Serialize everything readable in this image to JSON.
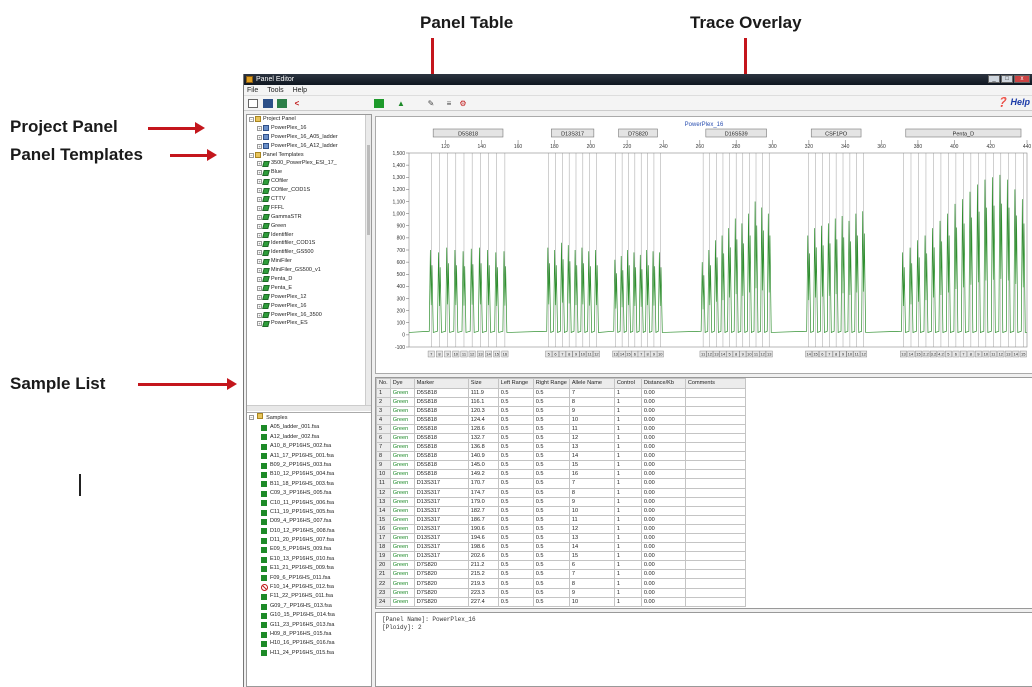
{
  "callouts": {
    "panel_table": "Panel Table",
    "trace_overlay": "Trace Overlay",
    "project_panel": "Project Panel",
    "panel_templates": "Panel Templates",
    "sample_list": "Sample List",
    "arrow_color": "#c4161c"
  },
  "window": {
    "title": "Panel Editor"
  },
  "menu": [
    "File",
    "Tools",
    "Help"
  ],
  "toolbar": {
    "help_label": "Help"
  },
  "tree": [
    {
      "label": "Project Panel",
      "level": 0,
      "pm": "−",
      "icon": "folder"
    },
    {
      "label": "PowerPlex_16",
      "level": 1,
      "pm": "+",
      "icon": "panel"
    },
    {
      "label": "PowerPlex_16_A05_ladder",
      "level": 1,
      "pm": "+",
      "icon": "panel"
    },
    {
      "label": "PowerPlex_16_A12_ladder",
      "level": 1,
      "pm": "+",
      "icon": "panel"
    },
    {
      "label": "Panel Templates",
      "level": 0,
      "pm": "−",
      "icon": "folder"
    },
    {
      "label": "3500_PowerPlex_ESI_17_",
      "level": 1,
      "pm": "+",
      "icon": "tmpl"
    },
    {
      "label": "Blue",
      "level": 1,
      "pm": "+",
      "icon": "tmpl"
    },
    {
      "label": "COfiler",
      "level": 1,
      "pm": "+",
      "icon": "tmpl"
    },
    {
      "label": "COfiler_COD1S",
      "level": 1,
      "pm": "+",
      "icon": "tmpl"
    },
    {
      "label": "CTTV",
      "level": 1,
      "pm": "+",
      "icon": "tmpl"
    },
    {
      "label": "FFFL",
      "level": 1,
      "pm": "+",
      "icon": "tmpl"
    },
    {
      "label": "GammaSTR",
      "level": 1,
      "pm": "+",
      "icon": "tmpl"
    },
    {
      "label": "Green",
      "level": 1,
      "pm": "+",
      "icon": "tmpl"
    },
    {
      "label": "Identifiler",
      "level": 1,
      "pm": "+",
      "icon": "tmpl"
    },
    {
      "label": "Identifiler_COD1S",
      "level": 1,
      "pm": "+",
      "icon": "tmpl"
    },
    {
      "label": "Identifiler_GS500",
      "level": 1,
      "pm": "+",
      "icon": "tmpl"
    },
    {
      "label": "MiniFiler",
      "level": 1,
      "pm": "+",
      "icon": "tmpl"
    },
    {
      "label": "MiniFiler_GS500_v1",
      "level": 1,
      "pm": "+",
      "icon": "tmpl"
    },
    {
      "label": "Penta_D",
      "level": 1,
      "pm": "+",
      "icon": "tmpl"
    },
    {
      "label": "Penta_E",
      "level": 1,
      "pm": "+",
      "icon": "tmpl"
    },
    {
      "label": "PowerPlex_12",
      "level": 1,
      "pm": "+",
      "icon": "tmpl"
    },
    {
      "label": "PowerPlex_16",
      "level": 1,
      "pm": "+",
      "icon": "tmpl"
    },
    {
      "label": "PowerPlex_16_3500",
      "level": 1,
      "pm": "+",
      "icon": "tmpl"
    },
    {
      "label": "PowerPlex_ES",
      "level": 1,
      "pm": "+",
      "icon": "tmpl"
    }
  ],
  "samples_root": "Samples",
  "samples": [
    {
      "name": "A05_ladder_001.fsa",
      "status": "ok"
    },
    {
      "name": "A12_ladder_002.fsa",
      "status": "ok"
    },
    {
      "name": "A10_8_PP16HS_002.fsa",
      "status": "ok"
    },
    {
      "name": "A11_17_PP16HS_001.fsa",
      "status": "ok"
    },
    {
      "name": "B09_2_PP16HS_003.fsa",
      "status": "ok"
    },
    {
      "name": "B10_12_PP16HS_004.fsa",
      "status": "ok"
    },
    {
      "name": "B11_18_PP16HS_003.fsa",
      "status": "ok"
    },
    {
      "name": "C09_3_PP16HS_005.fsa",
      "status": "ok"
    },
    {
      "name": "C10_11_PP16HS_006.fsa",
      "status": "ok"
    },
    {
      "name": "C11_19_PP16HS_005.fsa",
      "status": "ok"
    },
    {
      "name": "D09_4_PP16HS_007.fsa",
      "status": "ok"
    },
    {
      "name": "D10_12_PP16HS_008.fsa",
      "status": "ok"
    },
    {
      "name": "D11_20_PP16HS_007.fsa",
      "status": "ok"
    },
    {
      "name": "E09_5_PP16HS_009.fsa",
      "status": "ok"
    },
    {
      "name": "E10_13_PP16HS_010.fsa",
      "status": "ok"
    },
    {
      "name": "E11_21_PP16HS_009.fsa",
      "status": "ok"
    },
    {
      "name": "F09_6_PP16HS_011.fsa",
      "status": "ok"
    },
    {
      "name": "F10_14_PP16HS_012.fsa",
      "status": "error"
    },
    {
      "name": "F11_22_PP16HS_011.fsa",
      "status": "ok"
    },
    {
      "name": "G09_7_PP16HS_013.fsa",
      "status": "ok"
    },
    {
      "name": "G10_15_PP16HS_014.fsa",
      "status": "ok"
    },
    {
      "name": "G11_23_PP16HS_013.fsa",
      "status": "ok"
    },
    {
      "name": "H09_8_PP16HS_015.fsa",
      "status": "ok"
    },
    {
      "name": "H10_16_PP16HS_016.fsa",
      "status": "ok"
    },
    {
      "name": "H11_24_PP16HS_015.fsa",
      "status": "ok"
    }
  ],
  "chart_data": {
    "type": "line",
    "title": "PowerPlex_16",
    "xlim": [
      100,
      440
    ],
    "ylim": [
      -100,
      1500
    ],
    "x_ticks": [
      120,
      140,
      160,
      180,
      200,
      220,
      240,
      260,
      280,
      300,
      320,
      340,
      360,
      380,
      400,
      420,
      440
    ],
    "y_ticks": [
      -100,
      0,
      100,
      200,
      300,
      400,
      500,
      600,
      700,
      800,
      900,
      1000,
      1100,
      1200,
      1300,
      1400,
      1500
    ],
    "y_tick_labels": [
      "-100",
      "0",
      "100",
      "200",
      "300",
      "400",
      "500",
      "600",
      "700",
      "800",
      "900",
      "1,000",
      "1,100",
      "1,200",
      "1,300",
      "1,400",
      "1,500"
    ],
    "loci": [
      {
        "name": "D5S818",
        "start": 110,
        "end": 155,
        "heights": [
          700,
          680,
          720,
          700,
          690,
          710,
          720,
          700,
          680,
          690
        ],
        "peaks": 10
      },
      {
        "name": "D13S317",
        "start": 175,
        "end": 205,
        "heights": [
          720,
          700,
          760,
          740,
          700,
          720,
          690,
          700
        ],
        "peaks": 8
      },
      {
        "name": "D7S820",
        "start": 212,
        "end": 240,
        "heights": [
          620,
          650,
          700,
          680,
          660,
          700,
          690,
          680
        ],
        "peaks": 8
      },
      {
        "name": "D16S539",
        "start": 260,
        "end": 300,
        "heights": [
          600,
          700,
          780,
          820,
          880,
          960,
          920,
          1000,
          1100,
          1050,
          1000
        ],
        "peaks": 11
      },
      {
        "name": "CSF1PO",
        "start": 318,
        "end": 352,
        "heights": [
          820,
          880,
          900,
          920,
          960,
          980,
          940,
          1000,
          1020
        ],
        "peaks": 9
      },
      {
        "name": "Penta_D",
        "start": 370,
        "end": 440,
        "heights": [
          680,
          720,
          780,
          820,
          880,
          940,
          1000,
          1080,
          1120,
          1180,
          1240,
          1280,
          1300,
          1320,
          1280,
          1200,
          1120
        ],
        "peaks": 17
      }
    ],
    "baseline": 20,
    "line_color": "#2f8f2f",
    "bin_color": "#888888",
    "ladder_labels": [
      "7",
      "8",
      "9",
      "10",
      "11",
      "12",
      "13",
      "14",
      "15",
      "16",
      "5",
      "6",
      "7",
      "8",
      "9",
      "10",
      "11",
      "12",
      "13",
      "14",
      "15",
      "6",
      "7",
      "8",
      "9",
      "10",
      "11",
      "12",
      "13",
      "14",
      "5",
      "8",
      "9",
      "10",
      "11",
      "12",
      "13",
      "14",
      "15",
      "6",
      "7",
      "8",
      "9",
      "10",
      "11",
      "12",
      "13",
      "14",
      "15",
      "2.2",
      "3.2",
      "4.2",
      "5",
      "6",
      "7",
      "8",
      "9",
      "10",
      "11",
      "12",
      "13",
      "14",
      "15",
      "16",
      "17"
    ]
  },
  "table": {
    "headers": [
      "No.",
      "Dye",
      "Marker",
      "Size",
      "Left Range",
      "Right Range",
      "Allele Name",
      "Control",
      "Distance/Kb",
      "Comments"
    ],
    "rows": [
      [
        "1",
        "Green",
        "D5S818",
        "111.9",
        "0.5",
        "0.5",
        "7",
        "1",
        "0.00",
        ""
      ],
      [
        "2",
        "Green",
        "D5S818",
        "116.1",
        "0.5",
        "0.5",
        "8",
        "1",
        "0.00",
        ""
      ],
      [
        "3",
        "Green",
        "D5S818",
        "120.3",
        "0.5",
        "0.5",
        "9",
        "1",
        "0.00",
        ""
      ],
      [
        "4",
        "Green",
        "D5S818",
        "124.4",
        "0.5",
        "0.5",
        "10",
        "1",
        "0.00",
        ""
      ],
      [
        "5",
        "Green",
        "D5S818",
        "128.6",
        "0.5",
        "0.5",
        "11",
        "1",
        "0.00",
        ""
      ],
      [
        "6",
        "Green",
        "D5S818",
        "132.7",
        "0.5",
        "0.5",
        "12",
        "1",
        "0.00",
        ""
      ],
      [
        "7",
        "Green",
        "D5S818",
        "136.8",
        "0.5",
        "0.5",
        "13",
        "1",
        "0.00",
        ""
      ],
      [
        "8",
        "Green",
        "D5S818",
        "140.9",
        "0.5",
        "0.5",
        "14",
        "1",
        "0.00",
        ""
      ],
      [
        "9",
        "Green",
        "D5S818",
        "145.0",
        "0.5",
        "0.5",
        "15",
        "1",
        "0.00",
        ""
      ],
      [
        "10",
        "Green",
        "D5S818",
        "149.2",
        "0.5",
        "0.5",
        "16",
        "1",
        "0.00",
        ""
      ],
      [
        "11",
        "Green",
        "D13S317",
        "170.7",
        "0.5",
        "0.5",
        "7",
        "1",
        "0.00",
        ""
      ],
      [
        "12",
        "Green",
        "D13S317",
        "174.7",
        "0.5",
        "0.5",
        "8",
        "1",
        "0.00",
        ""
      ],
      [
        "13",
        "Green",
        "D13S317",
        "179.0",
        "0.5",
        "0.5",
        "9",
        "1",
        "0.00",
        ""
      ],
      [
        "14",
        "Green",
        "D13S317",
        "182.7",
        "0.5",
        "0.5",
        "10",
        "1",
        "0.00",
        ""
      ],
      [
        "15",
        "Green",
        "D13S317",
        "186.7",
        "0.5",
        "0.5",
        "11",
        "1",
        "0.00",
        ""
      ],
      [
        "16",
        "Green",
        "D13S317",
        "190.6",
        "0.5",
        "0.5",
        "12",
        "1",
        "0.00",
        ""
      ],
      [
        "17",
        "Green",
        "D13S317",
        "194.6",
        "0.5",
        "0.5",
        "13",
        "1",
        "0.00",
        ""
      ],
      [
        "18",
        "Green",
        "D13S317",
        "198.6",
        "0.5",
        "0.5",
        "14",
        "1",
        "0.00",
        ""
      ],
      [
        "19",
        "Green",
        "D13S317",
        "202.6",
        "0.5",
        "0.5",
        "15",
        "1",
        "0.00",
        ""
      ],
      [
        "20",
        "Green",
        "D7S820",
        "211.2",
        "0.5",
        "0.5",
        "6",
        "1",
        "0.00",
        ""
      ],
      [
        "21",
        "Green",
        "D7S820",
        "215.2",
        "0.5",
        "0.5",
        "7",
        "1",
        "0.00",
        ""
      ],
      [
        "22",
        "Green",
        "D7S820",
        "219.3",
        "0.5",
        "0.5",
        "8",
        "1",
        "0.00",
        ""
      ],
      [
        "23",
        "Green",
        "D7S820",
        "223.3",
        "0.5",
        "0.5",
        "9",
        "1",
        "0.00",
        ""
      ],
      [
        "24",
        "Green",
        "D7S820",
        "227.4",
        "0.5",
        "0.5",
        "10",
        "1",
        "0.00",
        ""
      ]
    ]
  },
  "console": {
    "line1": "[Panel Name]: PowerPlex_16",
    "line2": "[Ploidy]: 2"
  }
}
